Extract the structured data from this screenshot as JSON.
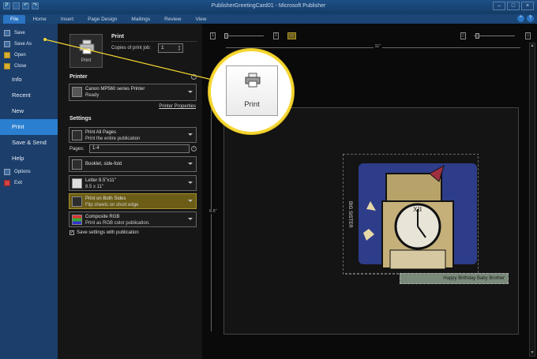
{
  "window": {
    "title": "PublisherGreetingCard01 - Microsoft Publisher",
    "buttons": [
      "–",
      "□",
      "×"
    ]
  },
  "ribbon": {
    "tabs": [
      "File",
      "Home",
      "Insert",
      "Page Design",
      "Mailings",
      "Review",
      "View"
    ]
  },
  "nav": {
    "quick": [
      {
        "label": "Save",
        "icon": "save-icon"
      },
      {
        "label": "Save As",
        "icon": "save-as-icon"
      },
      {
        "label": "Open",
        "icon": "folder-icon"
      },
      {
        "label": "Close",
        "icon": "close-file-icon"
      }
    ],
    "items": [
      "Info",
      "Recent",
      "New",
      "Print",
      "Save & Send",
      "Help"
    ],
    "bottom": [
      {
        "label": "Options",
        "icon": "options-icon"
      },
      {
        "label": "Exit",
        "icon": "exit-icon"
      }
    ]
  },
  "print": {
    "heading": "Print",
    "button_label": "Print",
    "copies_label": "Copies of print job:",
    "copies_value": "1"
  },
  "printer": {
    "heading": "Printer",
    "name": "Canon MP560 series Printer",
    "status": "Ready",
    "properties_link": "Printer Properties"
  },
  "settings": {
    "heading": "Settings",
    "what": {
      "line1": "Print All Pages",
      "line2": "Print the entire publication"
    },
    "pages_label": "Pages:",
    "pages_value": "1-4",
    "layout": {
      "line1": "Booklet, side-fold"
    },
    "paper": {
      "line1": "Letter 8.5\"x11\"",
      "line2": "8.5 x 11\""
    },
    "sides": {
      "line1": "Print on Both Sides",
      "line2": "Flip sheets on short edge"
    },
    "color": {
      "line1": "Composite RGB",
      "line2": "Print as RGB color publication."
    },
    "save_with_pub": "Save settings with publication",
    "save_with_pub_checked": "✓"
  },
  "preview": {
    "width_label": "11\"",
    "height_label": "8.5\"",
    "side_text": "BIG SISTER",
    "caption": "Happy Birthday Baby Brother"
  },
  "callout": {
    "button_label": "Print"
  },
  "colors": {
    "highlight": "#f5d632",
    "nav_active": "#2a7fd0",
    "file_tab": "#2b74c4"
  }
}
